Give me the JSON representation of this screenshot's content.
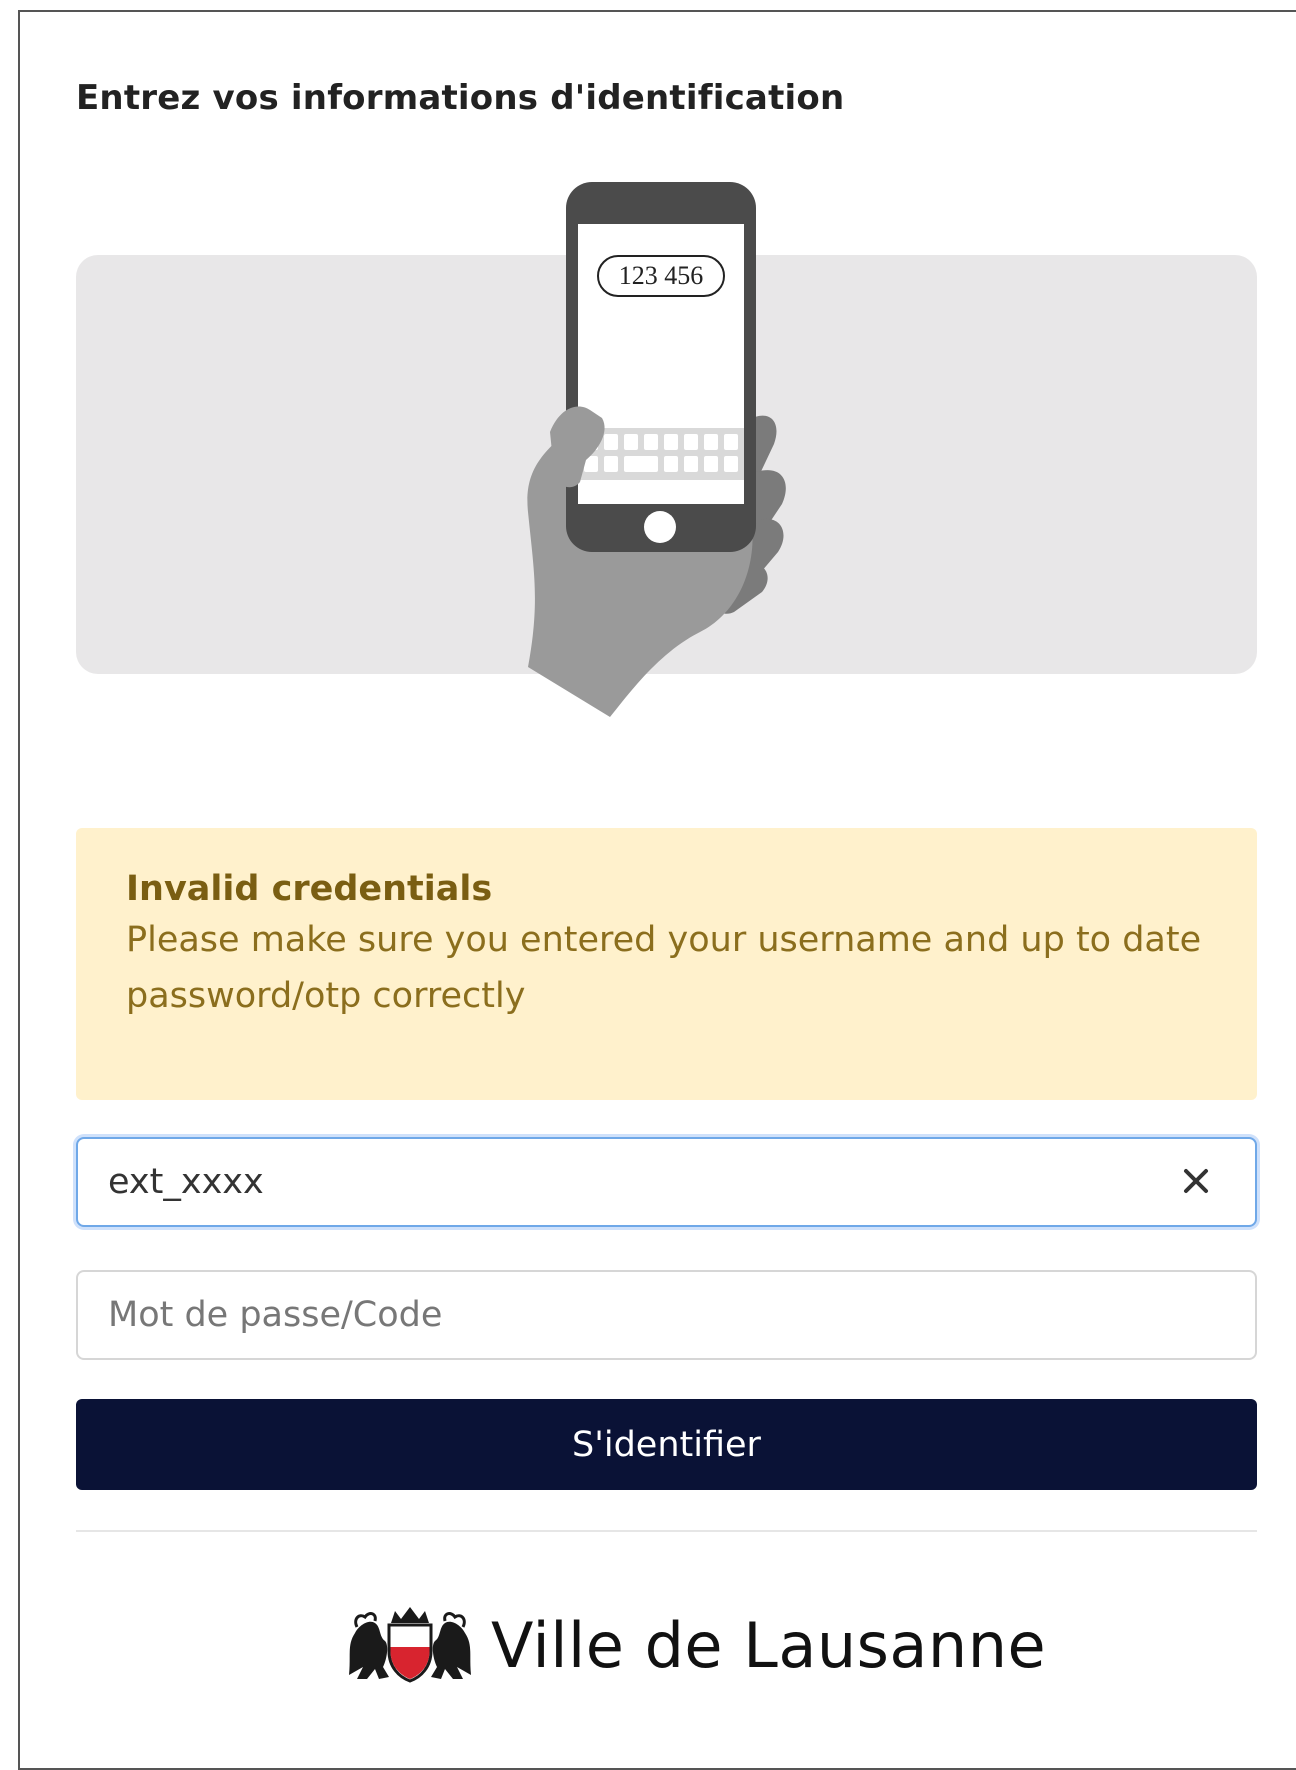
{
  "page": {
    "title": "Entrez vos informations d'identification"
  },
  "illustration": {
    "otp_code": "123 456",
    "icon": "phone-with-otp-illustration"
  },
  "alert": {
    "title": "Invalid credentials",
    "message": "Please make sure you entered your username and up to date password/otp correctly"
  },
  "form": {
    "username_value": "ext_xxxx",
    "password_placeholder": "Mot de passe/Code",
    "submit_label": "S'identifier",
    "clear_icon": "close-icon"
  },
  "footer": {
    "logo_text": "Ville de Lausanne",
    "crest_icon": "coat-of-arms-icon"
  },
  "colors": {
    "alert_bg": "#fff1cc",
    "alert_text": "#8b6e1d",
    "button_bg": "#0a1236",
    "focus_border": "#6fa8e8"
  }
}
